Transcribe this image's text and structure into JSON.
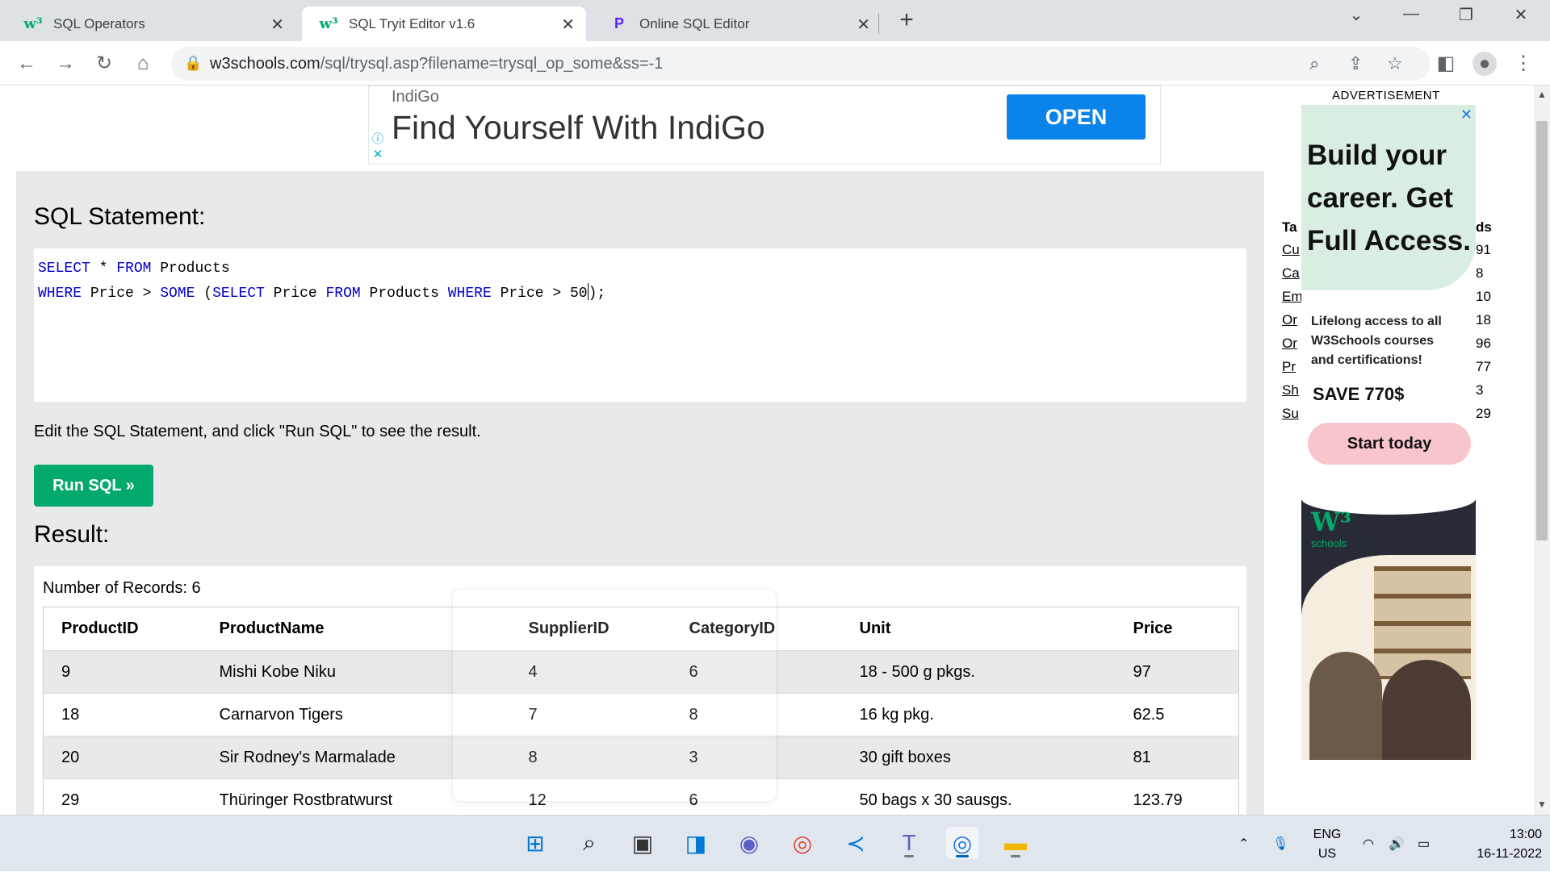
{
  "tabs": [
    {
      "label": "SQL Operators",
      "icon": "w3schools-icon"
    },
    {
      "label": "SQL Tryit Editor v1.6",
      "icon": "w3schools-icon"
    },
    {
      "label": "Online SQL Editor",
      "icon": "p-logo-icon"
    }
  ],
  "omnibox": {
    "domain": "w3schools.com",
    "path": "/sql/trysql.asp?filename=trysql_op_some&ss=-1"
  },
  "top_ad": {
    "brand": "IndiGo",
    "headline": "Find Yourself With IndiGo",
    "button": "OPEN"
  },
  "editor": {
    "heading": "SQL Statement:",
    "line1": {
      "kw1": "SELECT",
      "t1": " * ",
      "kw2": "FROM",
      "t2": " Products"
    },
    "line2": {
      "kw1": "WHERE",
      "t1": " Price > ",
      "kw2": "SOME",
      "t2": " (",
      "kw3": "SELECT",
      "t3": " Price ",
      "kw4": "FROM",
      "t4": " Products ",
      "kw5": "WHERE",
      "t5": " Price > 50",
      "t6": ");"
    },
    "hint": "Edit the SQL Statement, and click \"Run SQL\" to see the result.",
    "run_button": "Run SQL »"
  },
  "result": {
    "heading": "Result:",
    "records": "Number of Records: 6",
    "columns": [
      "ProductID",
      "ProductName",
      "SupplierID",
      "CategoryID",
      "Unit",
      "Price"
    ],
    "rows": [
      [
        "9",
        "Mishi Kobe Niku",
        "4",
        "6",
        "18 - 500 g pkgs.",
        "97"
      ],
      [
        "18",
        "Carnarvon Tigers",
        "7",
        "8",
        "16 kg pkg.",
        "62.5"
      ],
      [
        "20",
        "Sir Rodney's Marmalade",
        "8",
        "3",
        "30 gift boxes",
        "81"
      ],
      [
        "29",
        "Thüringer Rostbratwurst",
        "12",
        "6",
        "50 bags x 30 sausgs.",
        "123.79"
      ]
    ]
  },
  "side_panel": {
    "header_left": "Ta",
    "header_right": "ds",
    "links": [
      "Cu",
      "Ca",
      "Em",
      "Or",
      "Or",
      "Pr",
      "Sh",
      "Su"
    ],
    "counts": [
      "91",
      "8",
      "10",
      "18",
      "96",
      "77",
      "3",
      "29"
    ]
  },
  "career_ad": {
    "label": "ADVERTISEMENT",
    "line1": "Build your",
    "line2": "career. Get",
    "line3": "Full Access.",
    "sub1": "Lifelong access to all",
    "sub2": "W3Schools courses",
    "sub3": "and certifications!",
    "save": "SAVE 770$",
    "button": "Start today"
  },
  "w3_ad": {
    "logo": "W³",
    "sub": "schools"
  },
  "taskbar": {
    "lang1": "ENG",
    "lang2": "US",
    "time": "13:00",
    "date": "16-11-2022"
  },
  "colors": {
    "accent": "#04aa6d",
    "keyword": "#0000cd",
    "ad_button": "#0a84e8"
  }
}
